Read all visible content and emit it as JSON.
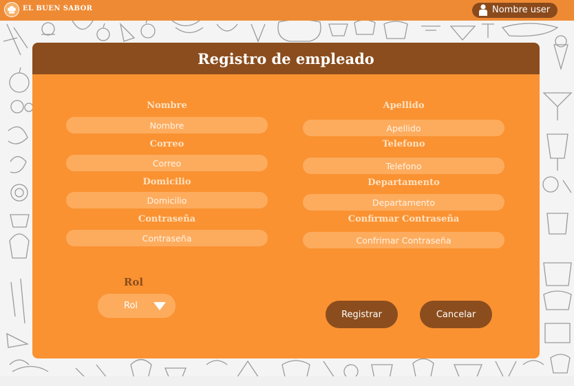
{
  "header": {
    "brand_name": "EL BUEN SABOR",
    "user_name": "Nombre user",
    "logo_icon": "chef-hat-icon",
    "user_icon": "user-icon"
  },
  "form": {
    "title": "Registro de empleado",
    "fields_left": [
      {
        "label": "Nombre",
        "placeholder": "Nombre"
      },
      {
        "label": "Correo",
        "placeholder": "Correo"
      },
      {
        "label": "Domicilio",
        "placeholder": "Domicilio"
      },
      {
        "label": "Contraseña",
        "placeholder": "Contraseña"
      }
    ],
    "fields_right": [
      {
        "label": "Apellido",
        "placeholder": "Apellido"
      },
      {
        "label": "Telefono",
        "placeholder": "Telefono"
      },
      {
        "label": "Departamento",
        "placeholder": "Departamento"
      },
      {
        "label": "Confirmar Contraseña",
        "placeholder": "Confrimar Contraseña"
      }
    ],
    "rol": {
      "label": "Rol",
      "selected": "Rol"
    },
    "buttons": {
      "submit": "Registrar",
      "cancel": "Cancelar"
    }
  },
  "colors": {
    "topbar": "#ef8a34",
    "card": "#fa9232",
    "header_brown": "#8b4d1d",
    "input_fill": "#fdac5e",
    "label_cream": "#ffe1c0"
  }
}
